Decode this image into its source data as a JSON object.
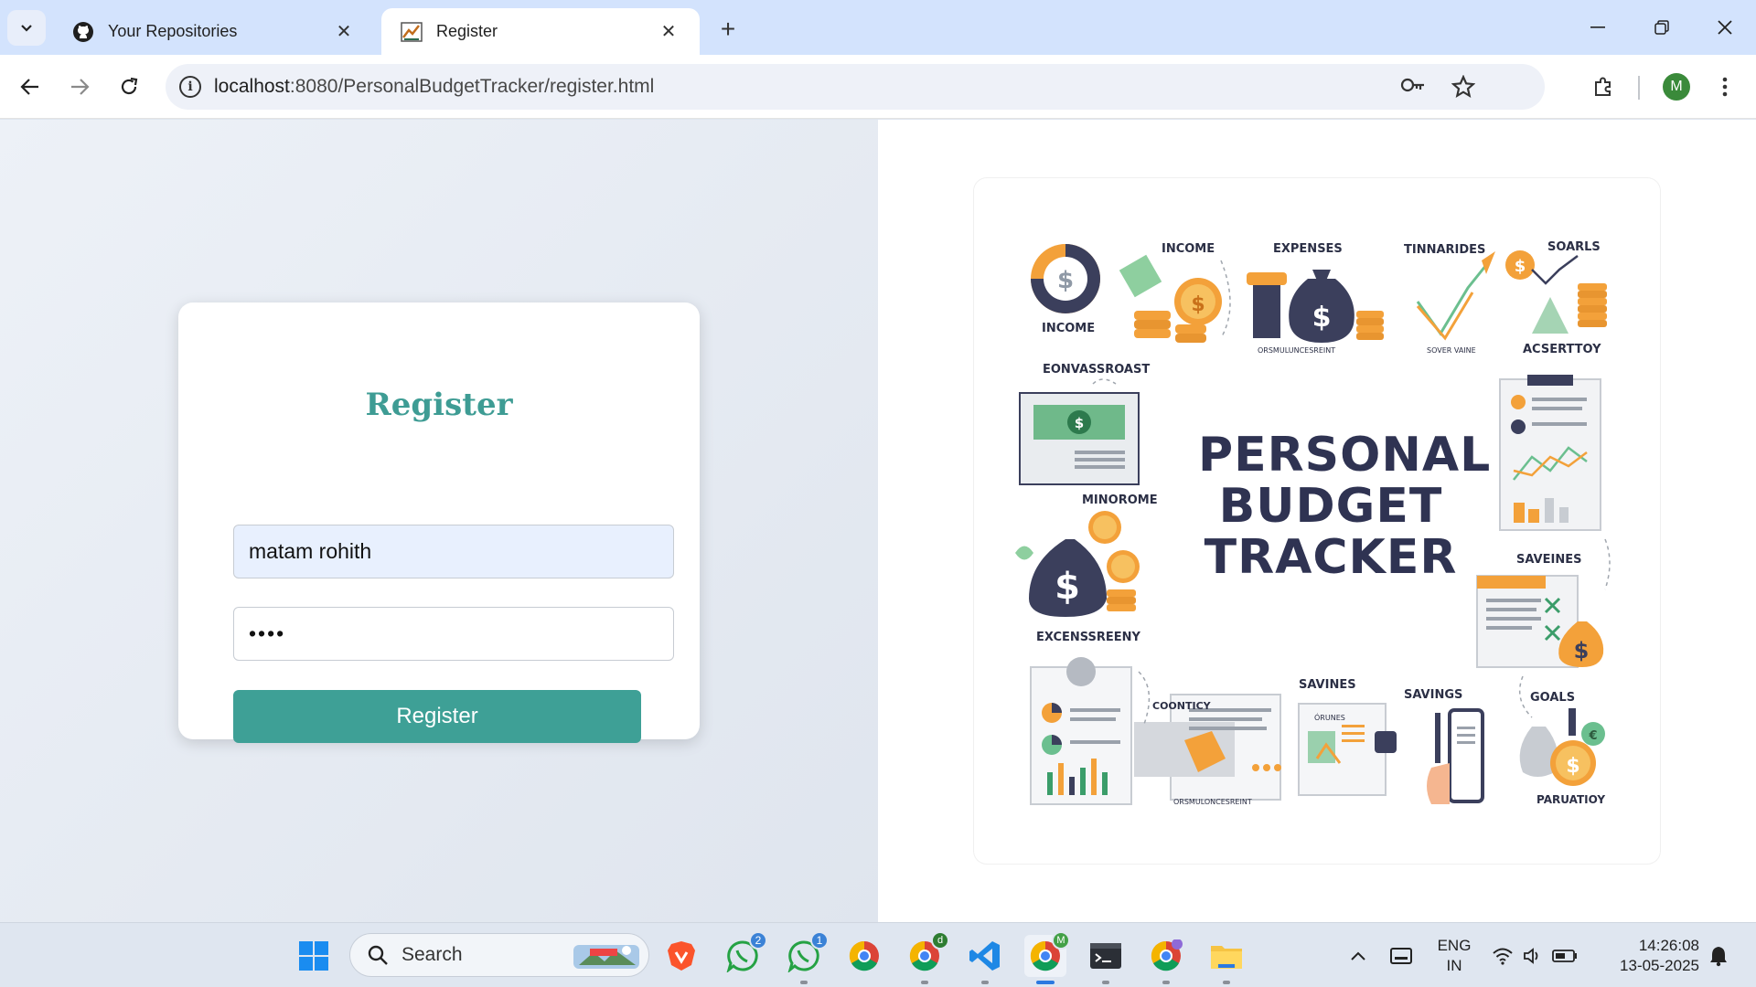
{
  "tabs": [
    {
      "label": "Your Repositories",
      "icon": "github-icon",
      "active": false
    },
    {
      "label": "Register",
      "icon": "page-favicon-icon",
      "active": true
    }
  ],
  "address": {
    "host": "localhost",
    "path": ":8080/PersonalBudgetTracker/register.html"
  },
  "profile_initial": "M",
  "form": {
    "title": "Register",
    "name_value": "matam rohith",
    "password_value": "••••",
    "button_label": "Register"
  },
  "illustration": {
    "title_lines": [
      "PERSONAL",
      "BUDGET",
      "TRACKER"
    ],
    "labels": {
      "income1": "INCOME",
      "income2": "INCOME",
      "expenses": "EXPENSES",
      "tinnarides": "TINNARIDES",
      "soarls": "SOARLS",
      "acserttoy": "ACSERTTOY",
      "orsmul1": "ORSMULUNCESREINT",
      "sover": "SOVER VAINE",
      "eonvassroast": "EONVASSROAST",
      "minorome": "MINOROME",
      "saveines": "SAVEINES",
      "excenssreeny": "EXCENSSREENY",
      "coonticy": "COONTICY",
      "savines": "SAVINES",
      "savings": "SAVINGS",
      "goals": "GOALS",
      "paruatioy": "PARUATIOY",
      "orsmul2": "ORSMULONCESREINT",
      "orunes": "ÓRUNES"
    }
  },
  "taskbar": {
    "search_label": "Search",
    "whatsapp1_badge": "2",
    "whatsapp2_badge": "1",
    "chrome_profile_d": "d",
    "chrome_profile_m": "M",
    "language": "ENG",
    "region": "IN",
    "time": "14:26:08",
    "date": "13-05-2025"
  },
  "colors": {
    "accent": "#3ea096",
    "title": "#3e9c94",
    "tabbar": "#d3e3fd"
  }
}
